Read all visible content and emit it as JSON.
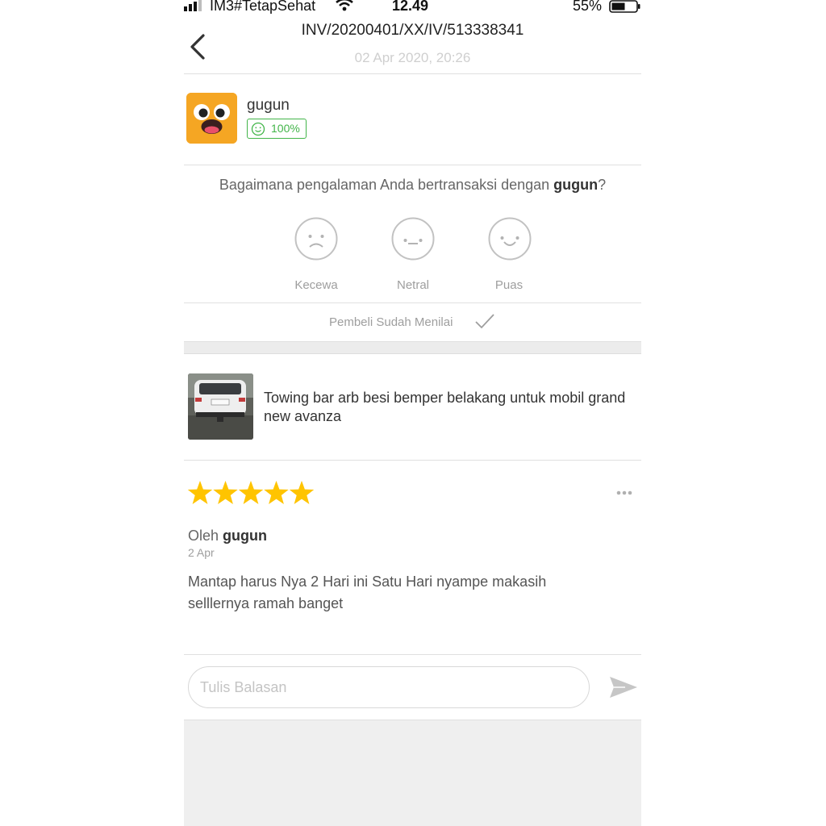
{
  "status_bar": {
    "carrier": "IM3#TetapSehat",
    "time": "12.49",
    "battery_percent": "55%",
    "battery_level": 0.55
  },
  "header": {
    "invoice_number": "INV/20200401/XX/IV/513338341",
    "datetime": "02 Apr 2020, 20:26",
    "back_icon": "chevron-left-icon"
  },
  "seller": {
    "name": "gugun",
    "reputation": "100%",
    "reputation_icon": "smile-icon",
    "badge_color": "#42b549"
  },
  "experience": {
    "question_prefix": "Bagaimana pengalaman Anda bertransaksi dengan ",
    "question_name": "gugun",
    "question_suffix": "?",
    "options": [
      {
        "label": "Kecewa",
        "icon": "sad-face-icon"
      },
      {
        "label": "Netral",
        "icon": "neutral-face-icon"
      },
      {
        "label": "Puas",
        "icon": "happy-face-icon"
      }
    ],
    "status_text": "Pembeli Sudah Menilai",
    "status_icon": "check-icon"
  },
  "product": {
    "title": "Towing bar arb besi bemper belakang untuk mobil grand new avanza"
  },
  "review": {
    "rating": 5,
    "max_rating": 5,
    "star_color": "#ffc400",
    "by_prefix": "Oleh ",
    "author": "gugun",
    "date": "2 Apr",
    "text": "Mantap harus Nya 2 Hari ini Satu Hari nyampe makasih selllernya ramah banget"
  },
  "reply": {
    "placeholder": "Tulis Balasan",
    "value": ""
  }
}
